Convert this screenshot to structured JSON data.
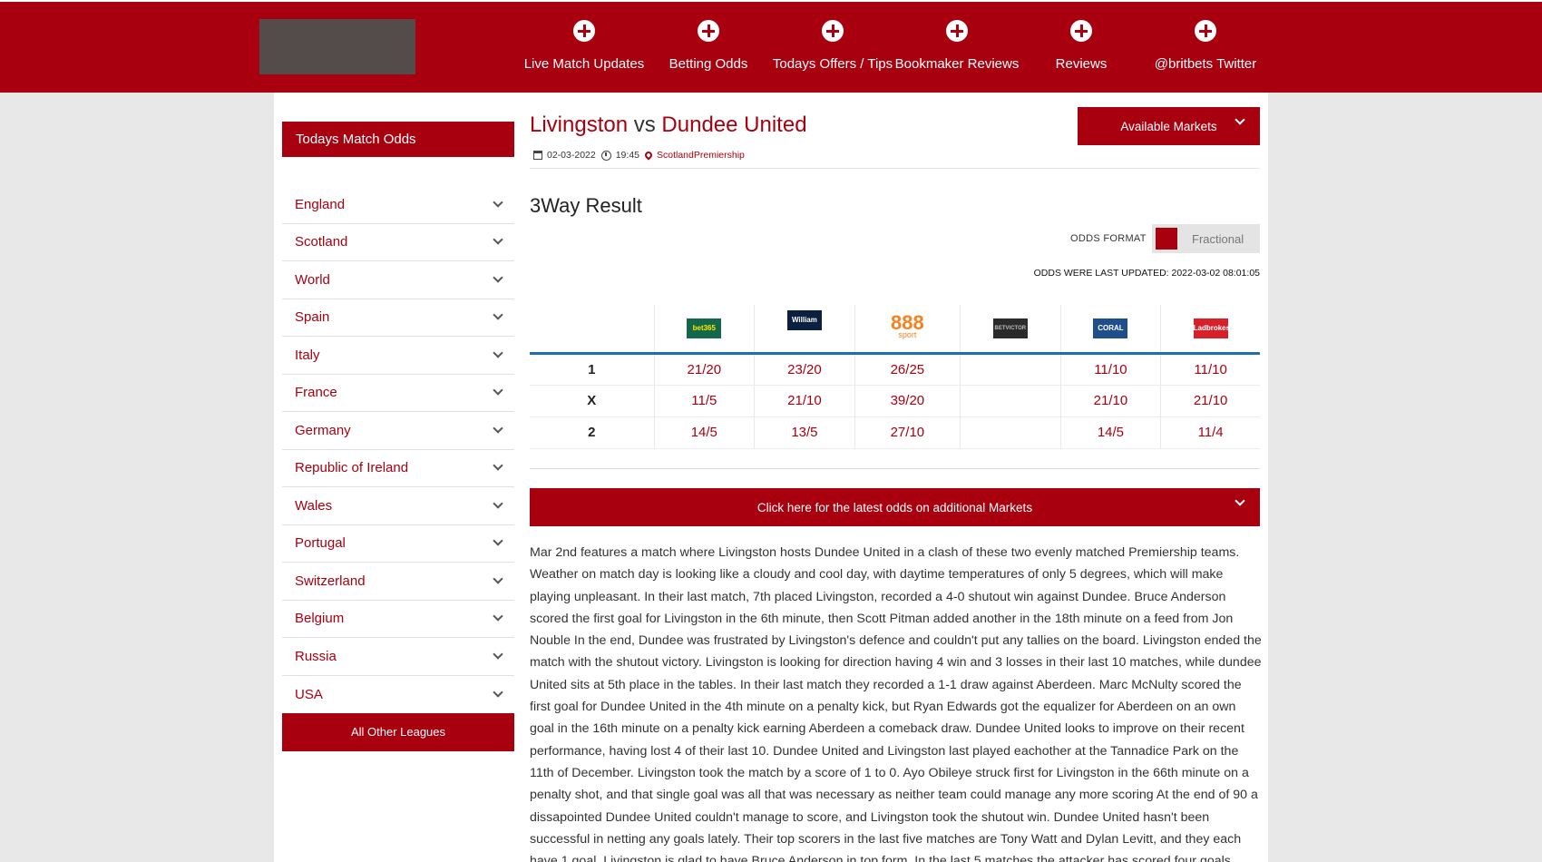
{
  "nav": {
    "items": [
      {
        "label": "Live Match Updates"
      },
      {
        "label": "Betting Odds"
      },
      {
        "label": "Todays Offers / Tips"
      },
      {
        "label": "Bookmaker Reviews"
      },
      {
        "label": "Reviews"
      },
      {
        "label": "@britbets Twitter"
      }
    ]
  },
  "sidebar": {
    "header": "Todays Match Odds",
    "items": [
      {
        "label": "England"
      },
      {
        "label": "Scotland"
      },
      {
        "label": "World"
      },
      {
        "label": "Spain"
      },
      {
        "label": "Italy"
      },
      {
        "label": "France"
      },
      {
        "label": "Germany"
      },
      {
        "label": "Republic of Ireland"
      },
      {
        "label": "Wales"
      },
      {
        "label": "Portugal"
      },
      {
        "label": "Switzerland"
      },
      {
        "label": "Belgium"
      },
      {
        "label": "Russia"
      },
      {
        "label": "USA"
      }
    ],
    "other_leagues": "All Other Leagues"
  },
  "match": {
    "home": "Livingston",
    "vs": "vs",
    "away": "Dundee United",
    "date": "02-03-2022",
    "time": "19:45",
    "league": "ScotlandPremiership"
  },
  "available_markets": "Available Markets",
  "market": {
    "title": "3Way Result",
    "odds_format_label": "ODDS FORMAT",
    "odds_format_value": "Fractional",
    "updated": "ODDS WERE LAST UPDATED: 2022-03-02 08:01:05"
  },
  "bookmakers": [
    {
      "name": "bet365"
    },
    {
      "name": "William HILL"
    },
    {
      "name": "888",
      "sub": "sport"
    },
    {
      "name": "BETVICTOR"
    },
    {
      "name": "CORAL"
    },
    {
      "name": "Ladbrokes"
    }
  ],
  "odds_rows": [
    {
      "outcome": "1",
      "odds": [
        "21/20",
        "23/20",
        "26/25",
        "",
        "11/10",
        "11/10"
      ]
    },
    {
      "outcome": "X",
      "odds": [
        "11/5",
        "21/10",
        "39/20",
        "",
        "21/10",
        "21/10"
      ]
    },
    {
      "outcome": "2",
      "odds": [
        "14/5",
        "13/5",
        "27/10",
        "",
        "14/5",
        "11/4"
      ]
    }
  ],
  "more_markets": "Click here for the latest odds on additional Markets",
  "article": "Mar 2nd features a match where Livingston hosts Dundee United in a clash of these two evenly matched Premiership teams. Weather on match day is looking like a cloudy and cool day, with daytime temperatures of only 5 degrees, which will make playing unpleasant. In their last match, 7th placed Livingston, recorded a 4-0 shutout win against Dundee. Bruce Anderson scored the first goal for Livingston in the 6th minute, then Scott Pitman added another in the 18th minute on a feed from Jon Nouble In the end, Dundee was frustrated by Livingston's defence and couldn't put any tallies on the board. Livingston ended the match with the shutout victory. Livingston is looking for direction having 4 win and 3 losses in their last 10 matches, while dundee United sits at 5th place in the tables. In their last match they recorded a 1-1 draw against Aberdeen. Marc McNulty scored the first goal for Dundee United in the 4th minute on a penalty kick, but Ryan Edwards got the equalizer for Aberdeen on an own goal in the 16th minute on a penalty kick earning Aberdeen a comeback draw. Dundee United looks to improve on their recent performance, having lost 4 of their last 10. Dundee United and Livingston last played eachother at the Tannadice Park on the 11th of December. Livingston took the match by a score of 1 to 0. Ayo Obileye struck first for Livingston in the 66th minute on a penalty shot, and that single goal was all that was necessary as neither team could manage any more scoring At the end of 90 a dissapointed Dundee United couldn't manage to score, and Livingston took the shutout win. Dundee United hasn't been successful in netting any goals lately. Their top scorers in the last five matches are Tony Watt and Dylan Levitt, and they each have 1 goal. Livingston is glad to have Bruce Anderson in top form. In the last 5 matches the attacker has scored four goals."
}
